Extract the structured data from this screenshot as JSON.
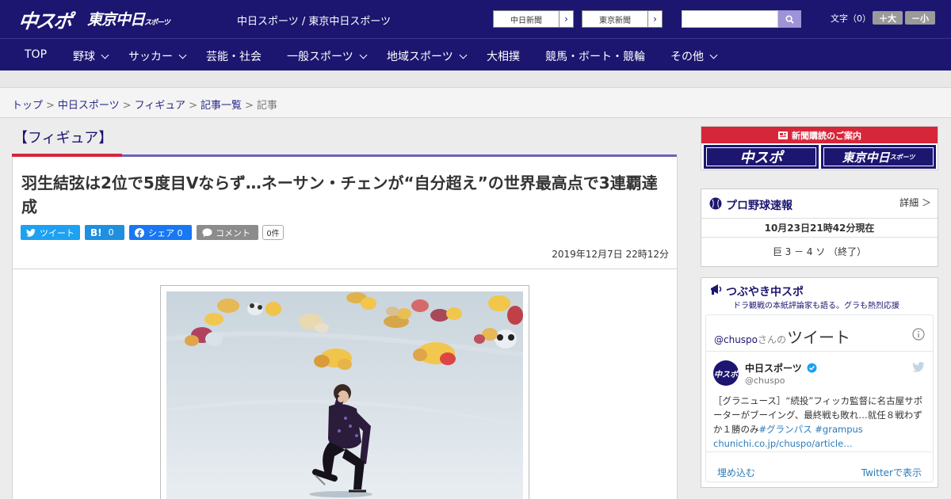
{
  "header": {
    "logo_main": "中スポ",
    "logo_tokyo": "東京中日",
    "logo_tokyo_small": "スポーツ",
    "site_title": "中日スポーツ / 東京中日スポーツ",
    "links": [
      {
        "label": "中日新聞"
      },
      {
        "label": "東京新聞"
      }
    ],
    "search": {
      "placeholder": ""
    },
    "font_size": {
      "label": "文字（0）",
      "larger": "＋大",
      "smaller": "－小"
    }
  },
  "nav": {
    "items": [
      {
        "label": "TOP"
      },
      {
        "label": "野球"
      },
      {
        "label": "サッカー"
      },
      {
        "label": "芸能・社会"
      },
      {
        "label": "一般スポーツ"
      },
      {
        "label": "地域スポーツ"
      },
      {
        "label": "大相撲"
      },
      {
        "label": "競馬・ボート・競輪"
      },
      {
        "label": "その他"
      }
    ]
  },
  "breadcrumb": {
    "items": [
      "トップ",
      "中日スポーツ",
      "フィギュア",
      "記事一覧"
    ],
    "current": "記事"
  },
  "article": {
    "category": "【フィギュア】",
    "headline": "羽生結弦は2位で5度目Vならず…ネーサン・チェンが“自分超え”の世界最高点で3連覇達成",
    "share": {
      "tweet": "ツイート",
      "hatena_count": "0",
      "facebook": "シェア 0",
      "comment": "コメント",
      "comment_count": "0件"
    },
    "date": "2019年12月7日 22時12分"
  },
  "sidebar": {
    "subscription": {
      "title": "新聞購読のご案内",
      "chuspo": "中スポ",
      "tokyo": "東京中日",
      "tokyo_small": "スポーツ"
    },
    "baseball": {
      "title": "プロ野球速報",
      "detail": "詳細 ＞",
      "timestamp": "10月23日21時42分現在",
      "score": "巨 3 － 4 ソ （終了）"
    },
    "tweets": {
      "title": "つぶやき中スポ",
      "subtitle": "ドラ観戦の本紙評論家も語る。グラも熱烈応援",
      "handle_prefix": "@chuspo",
      "handle_suffix": "さんの",
      "tweet_word": "ツイート",
      "account_name": "中日スポーツ",
      "account_handle": "@chuspo",
      "tweet_text": "［グラニュース］“続投”フィッカ監督に名古屋サポーターがブーイング、最終戦も敗れ…就任８戦わずか１勝のみ",
      "hashtag1": "#グランパス",
      "hashtag2": "#grampus",
      "link": "chunichi.co.jp/chuspo/article…",
      "embed": "埋め込む",
      "view_on_twitter": "Twitterで表示"
    }
  }
}
